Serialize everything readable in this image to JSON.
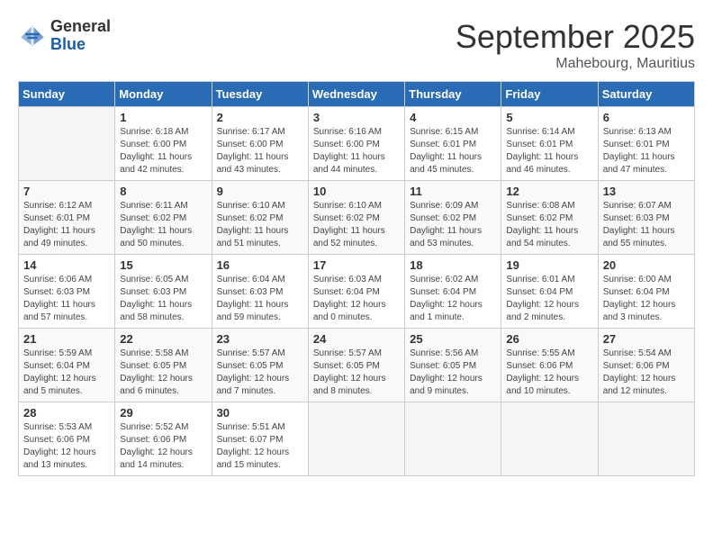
{
  "logo": {
    "general": "General",
    "blue": "Blue"
  },
  "title": "September 2025",
  "subtitle": "Mahebourg, Mauritius",
  "days_of_week": [
    "Sunday",
    "Monday",
    "Tuesday",
    "Wednesday",
    "Thursday",
    "Friday",
    "Saturday"
  ],
  "weeks": [
    [
      {
        "day": "",
        "sunrise": "",
        "sunset": "",
        "daylight": ""
      },
      {
        "day": "1",
        "sunrise": "Sunrise: 6:18 AM",
        "sunset": "Sunset: 6:00 PM",
        "daylight": "Daylight: 11 hours and 42 minutes."
      },
      {
        "day": "2",
        "sunrise": "Sunrise: 6:17 AM",
        "sunset": "Sunset: 6:00 PM",
        "daylight": "Daylight: 11 hours and 43 minutes."
      },
      {
        "day": "3",
        "sunrise": "Sunrise: 6:16 AM",
        "sunset": "Sunset: 6:00 PM",
        "daylight": "Daylight: 11 hours and 44 minutes."
      },
      {
        "day": "4",
        "sunrise": "Sunrise: 6:15 AM",
        "sunset": "Sunset: 6:01 PM",
        "daylight": "Daylight: 11 hours and 45 minutes."
      },
      {
        "day": "5",
        "sunrise": "Sunrise: 6:14 AM",
        "sunset": "Sunset: 6:01 PM",
        "daylight": "Daylight: 11 hours and 46 minutes."
      },
      {
        "day": "6",
        "sunrise": "Sunrise: 6:13 AM",
        "sunset": "Sunset: 6:01 PM",
        "daylight": "Daylight: 11 hours and 47 minutes."
      }
    ],
    [
      {
        "day": "7",
        "sunrise": "Sunrise: 6:12 AM",
        "sunset": "Sunset: 6:01 PM",
        "daylight": "Daylight: 11 hours and 49 minutes."
      },
      {
        "day": "8",
        "sunrise": "Sunrise: 6:11 AM",
        "sunset": "Sunset: 6:02 PM",
        "daylight": "Daylight: 11 hours and 50 minutes."
      },
      {
        "day": "9",
        "sunrise": "Sunrise: 6:10 AM",
        "sunset": "Sunset: 6:02 PM",
        "daylight": "Daylight: 11 hours and 51 minutes."
      },
      {
        "day": "10",
        "sunrise": "Sunrise: 6:10 AM",
        "sunset": "Sunset: 6:02 PM",
        "daylight": "Daylight: 11 hours and 52 minutes."
      },
      {
        "day": "11",
        "sunrise": "Sunrise: 6:09 AM",
        "sunset": "Sunset: 6:02 PM",
        "daylight": "Daylight: 11 hours and 53 minutes."
      },
      {
        "day": "12",
        "sunrise": "Sunrise: 6:08 AM",
        "sunset": "Sunset: 6:02 PM",
        "daylight": "Daylight: 11 hours and 54 minutes."
      },
      {
        "day": "13",
        "sunrise": "Sunrise: 6:07 AM",
        "sunset": "Sunset: 6:03 PM",
        "daylight": "Daylight: 11 hours and 55 minutes."
      }
    ],
    [
      {
        "day": "14",
        "sunrise": "Sunrise: 6:06 AM",
        "sunset": "Sunset: 6:03 PM",
        "daylight": "Daylight: 11 hours and 57 minutes."
      },
      {
        "day": "15",
        "sunrise": "Sunrise: 6:05 AM",
        "sunset": "Sunset: 6:03 PM",
        "daylight": "Daylight: 11 hours and 58 minutes."
      },
      {
        "day": "16",
        "sunrise": "Sunrise: 6:04 AM",
        "sunset": "Sunset: 6:03 PM",
        "daylight": "Daylight: 11 hours and 59 minutes."
      },
      {
        "day": "17",
        "sunrise": "Sunrise: 6:03 AM",
        "sunset": "Sunset: 6:04 PM",
        "daylight": "Daylight: 12 hours and 0 minutes."
      },
      {
        "day": "18",
        "sunrise": "Sunrise: 6:02 AM",
        "sunset": "Sunset: 6:04 PM",
        "daylight": "Daylight: 12 hours and 1 minute."
      },
      {
        "day": "19",
        "sunrise": "Sunrise: 6:01 AM",
        "sunset": "Sunset: 6:04 PM",
        "daylight": "Daylight: 12 hours and 2 minutes."
      },
      {
        "day": "20",
        "sunrise": "Sunrise: 6:00 AM",
        "sunset": "Sunset: 6:04 PM",
        "daylight": "Daylight: 12 hours and 3 minutes."
      }
    ],
    [
      {
        "day": "21",
        "sunrise": "Sunrise: 5:59 AM",
        "sunset": "Sunset: 6:04 PM",
        "daylight": "Daylight: 12 hours and 5 minutes."
      },
      {
        "day": "22",
        "sunrise": "Sunrise: 5:58 AM",
        "sunset": "Sunset: 6:05 PM",
        "daylight": "Daylight: 12 hours and 6 minutes."
      },
      {
        "day": "23",
        "sunrise": "Sunrise: 5:57 AM",
        "sunset": "Sunset: 6:05 PM",
        "daylight": "Daylight: 12 hours and 7 minutes."
      },
      {
        "day": "24",
        "sunrise": "Sunrise: 5:57 AM",
        "sunset": "Sunset: 6:05 PM",
        "daylight": "Daylight: 12 hours and 8 minutes."
      },
      {
        "day": "25",
        "sunrise": "Sunrise: 5:56 AM",
        "sunset": "Sunset: 6:05 PM",
        "daylight": "Daylight: 12 hours and 9 minutes."
      },
      {
        "day": "26",
        "sunrise": "Sunrise: 5:55 AM",
        "sunset": "Sunset: 6:06 PM",
        "daylight": "Daylight: 12 hours and 10 minutes."
      },
      {
        "day": "27",
        "sunrise": "Sunrise: 5:54 AM",
        "sunset": "Sunset: 6:06 PM",
        "daylight": "Daylight: 12 hours and 12 minutes."
      }
    ],
    [
      {
        "day": "28",
        "sunrise": "Sunrise: 5:53 AM",
        "sunset": "Sunset: 6:06 PM",
        "daylight": "Daylight: 12 hours and 13 minutes."
      },
      {
        "day": "29",
        "sunrise": "Sunrise: 5:52 AM",
        "sunset": "Sunset: 6:06 PM",
        "daylight": "Daylight: 12 hours and 14 minutes."
      },
      {
        "day": "30",
        "sunrise": "Sunrise: 5:51 AM",
        "sunset": "Sunset: 6:07 PM",
        "daylight": "Daylight: 12 hours and 15 minutes."
      },
      {
        "day": "",
        "sunrise": "",
        "sunset": "",
        "daylight": ""
      },
      {
        "day": "",
        "sunrise": "",
        "sunset": "",
        "daylight": ""
      },
      {
        "day": "",
        "sunrise": "",
        "sunset": "",
        "daylight": ""
      },
      {
        "day": "",
        "sunrise": "",
        "sunset": "",
        "daylight": ""
      }
    ]
  ]
}
